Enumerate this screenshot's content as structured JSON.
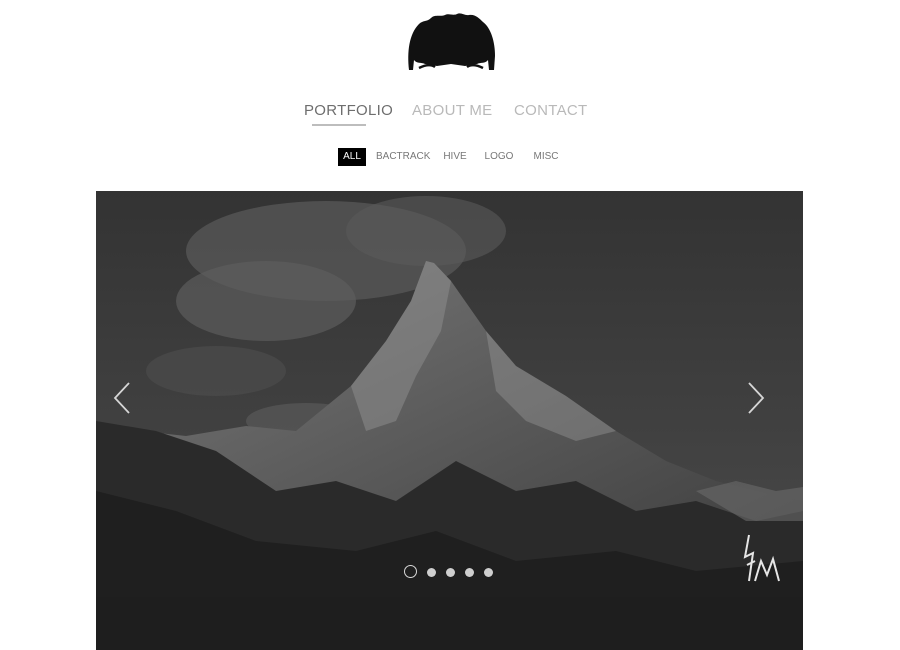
{
  "nav": {
    "items": [
      {
        "label": "PORTFOLIO",
        "active": true
      },
      {
        "label": "ABOUT ME",
        "active": false
      },
      {
        "label": "CONTACT",
        "active": false
      }
    ]
  },
  "filters": [
    {
      "label": "ALL",
      "active": true
    },
    {
      "label": "BACTRACK",
      "active": false
    },
    {
      "label": "HIVE",
      "active": false
    },
    {
      "label": "LOGO",
      "active": false
    },
    {
      "label": "MISC",
      "active": false
    }
  ],
  "slider": {
    "image": "mountain-peak-monochrome",
    "prev_icon": "chevron-left-icon",
    "next_icon": "chevron-right-icon",
    "dots_count": 5,
    "active_dot": 1
  },
  "colors": {
    "background": "#ffffff",
    "nav_active": "#6e6e6e",
    "nav_inactive": "#b9b9b9",
    "filter_active_bg": "#000000",
    "footer_band": "#1e1e1e"
  }
}
